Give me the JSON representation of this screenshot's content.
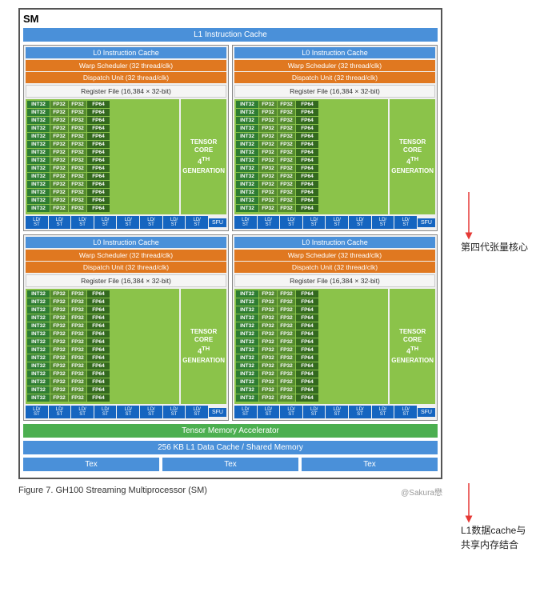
{
  "sm": {
    "title": "SM",
    "l1_instruction_cache": "L1 Instruction Cache",
    "l0_instruction_cache": "L0 Instruction Cache",
    "warp_scheduler": "Warp Scheduler (32 thread/clk)",
    "dispatch_unit": "Dispatch Unit (32 thread/clk)",
    "register_file": "Register File (16,384 × 32-bit)",
    "tensor_core": "TENSOR CORE",
    "generation": "4TH GENERATION",
    "tensor_memory_accelerator": "Tensor Memory Accelerator",
    "l1_data_cache": "256 KB L1 Data Cache / Shared Memory",
    "tex": "Tex",
    "sfu": "SFU",
    "int32": "INT32",
    "fp32a": "FP32",
    "fp32b": "FP32",
    "fp64": "FP64",
    "ldst": "LD/\nST"
  },
  "figure": {
    "caption": "Figure 7.    GH100 Streaming Multiprocessor (SM)"
  },
  "annotations": {
    "fourth_gen": "第四代张量核心",
    "l1_cache": "L1数据cache与\n共享内存结合"
  },
  "csdn": "@Sakura懋"
}
